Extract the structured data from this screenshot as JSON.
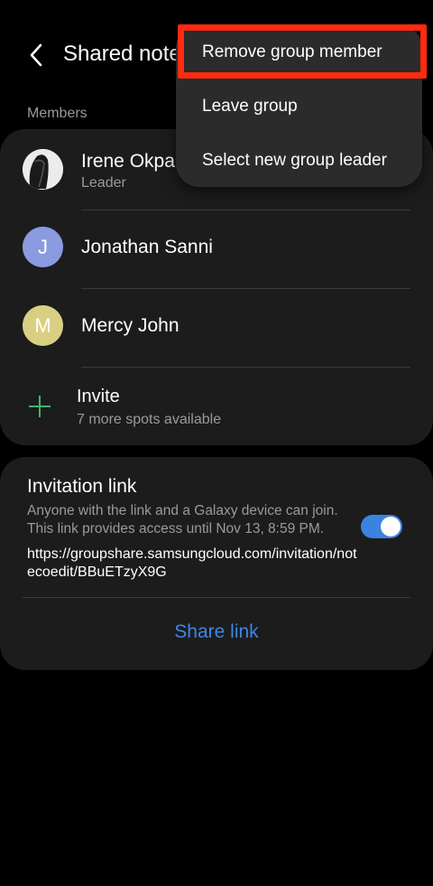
{
  "header": {
    "title": "Shared note"
  },
  "members_section": {
    "label": "Members",
    "members": [
      {
        "name": "Irene Okpara",
        "role": "Leader",
        "initial": "",
        "color": "#222222"
      },
      {
        "name": "Jonathan Sanni",
        "role": "",
        "initial": "J",
        "color": "#8a9be0"
      },
      {
        "name": "Mercy John",
        "role": "",
        "initial": "M",
        "color": "#d9cf82"
      }
    ],
    "invite": {
      "label": "Invite",
      "sub": "7 more spots available"
    }
  },
  "invitation": {
    "title": "Invitation link",
    "description": "Anyone with the link and a Galaxy device can join. This link provides access until Nov 13, 8:59 PM.",
    "url": "https://groupshare.samsungcloud.com/invitation/notecoedit/BBuETzyX9G",
    "toggle_on": true,
    "share_label": "Share link",
    "accent": "#3d87e6"
  },
  "menu": {
    "items": [
      "Remove group member",
      "Leave group",
      "Select new group leader"
    ]
  }
}
